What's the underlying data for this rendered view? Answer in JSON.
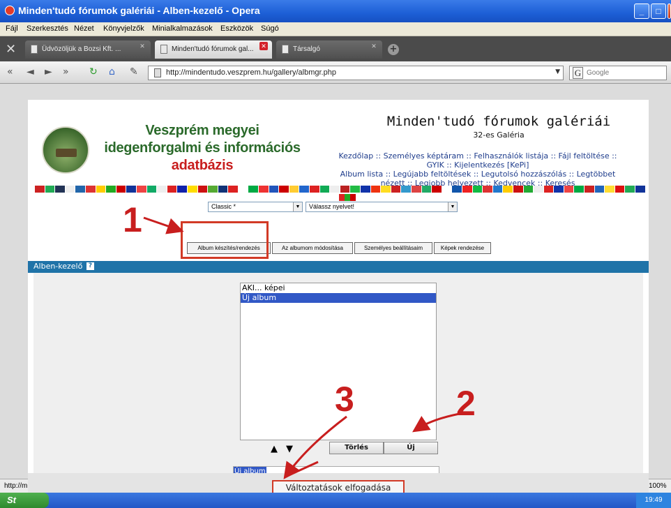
{
  "window": {
    "title": "Minden'tudó fórumok galériái - Alben-kezelő - Opera"
  },
  "menu": [
    "Fájl",
    "Szerkesztés",
    "Nézet",
    "Könyvjelzők",
    "Minialkalmazások",
    "Eszközök",
    "Súgó"
  ],
  "tabs": [
    {
      "label": "Üdvözöljük a Bozsi Kft. ..."
    },
    {
      "label": "Minden'tudó fórumok gal..."
    },
    {
      "label": "Társalgó"
    }
  ],
  "address": {
    "url": "http://mindentudo.veszprem.hu/gallery/albmgr.php",
    "search_placeholder": "Google"
  },
  "site": {
    "title_line1": "Veszprém megyei",
    "title_line2": "idegenforgalmi és információs",
    "title_line3": "adatbázis",
    "gallery_title": "Minden'tudó fórumok galériái",
    "gallery_sub": "32-es Galéria",
    "nav_line1": "Kezdőlap :: Személyes képtáram :: Felhasználók listája :: Fájl feltöltése ::",
    "nav_line2": "GYIK :: Kijelentkezés [KePi]",
    "nav_line3": "Album lista :: Legújabb feltöltések :: Legutolsó hozzászólás :: Legtöbbet",
    "nav_line4": "nézett :: Legjobb helyezett :: Kedvencek :: Keresés"
  },
  "selects": {
    "theme": "Classic *",
    "language": "Válassz nyelvet!"
  },
  "subtabs": [
    "Album készítés/rendezés",
    "Az albumom módosítása",
    "Személyes beállításaim",
    "Képek rendezése"
  ],
  "panel": {
    "title": "Alben-kezelő",
    "help": "?",
    "albums": [
      {
        "name": "AKI... képei",
        "selected": false
      },
      {
        "name": "Új album",
        "selected": true
      }
    ],
    "up": "▲",
    "down": "▼",
    "delete_label": "Törlés",
    "new_label": "Új",
    "name_value": "Új album",
    "accept_label": "Változtatások elfogadása"
  },
  "status": {
    "url": "http://m",
    "zoom": "100%"
  },
  "taskbar": {
    "start": "St",
    "clock": "19:49"
  },
  "annotations": {
    "n1": "1",
    "n2": "2",
    "n3": "3",
    "color": "#c81e1e"
  },
  "flag_colors": [
    "#c22",
    "#2a5",
    "#235",
    "#eee",
    "#26a",
    "#d33",
    "#fc0",
    "#2a2",
    "#c00",
    "#139",
    "#e44",
    "#1a6",
    "#eee",
    "#d22",
    "#12a",
    "#fd0",
    "#c11",
    "#5a3",
    "#137",
    "#d22",
    "#fff",
    "#0a4",
    "#e33",
    "#25b",
    "#c00",
    "#fc3",
    "#26c",
    "#d22",
    "#1a5",
    "#eee",
    "#b22",
    "#2b4",
    "#13a",
    "#e31",
    "#fd2",
    "#c22",
    "#39c",
    "#d44",
    "#2a6",
    "#c00",
    "#fff",
    "#15a",
    "#e22",
    "#1b4",
    "#d33",
    "#27c",
    "#fc0",
    "#c11",
    "#2a3",
    "#eee",
    "#d22",
    "#13a",
    "#e44",
    "#0a4",
    "#c22",
    "#26b",
    "#fd3",
    "#d11",
    "#2a5",
    "#139"
  ]
}
